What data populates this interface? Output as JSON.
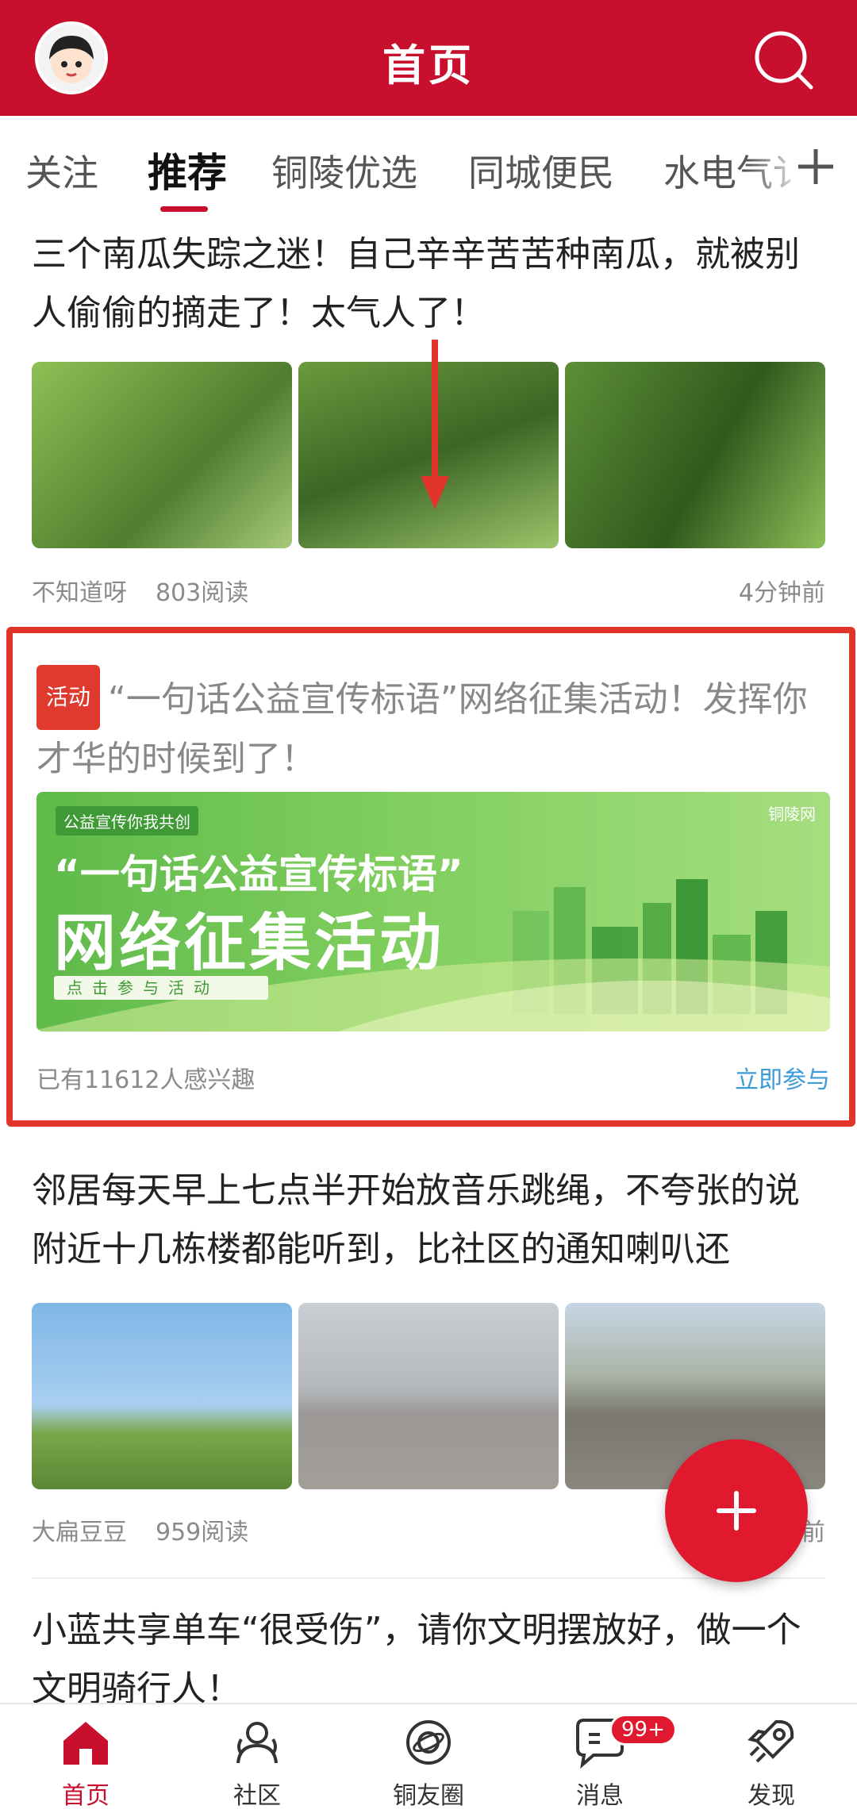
{
  "header": {
    "title": "首页"
  },
  "tabs": [
    {
      "label": "关注",
      "active": false
    },
    {
      "label": "推荐",
      "active": true
    },
    {
      "label": "铜陵优选",
      "active": false
    },
    {
      "label": "同城便民",
      "active": false
    },
    {
      "label": "水电气讠",
      "active": false
    }
  ],
  "feed": {
    "article1": {
      "title": "三个南瓜失踪之迷！自己辛辛苦苦种南瓜，就被别人偷偷的摘走了！太气人了！",
      "author": "不知道呀",
      "reads": "803阅读",
      "time": "4分钟前"
    },
    "activity": {
      "badge": "活动",
      "title": "“一句话公益宣传标语”网络征集活动！发挥你才华的时候到了！",
      "banner_tag": "公益宣传你我共创",
      "banner_logo": "铜陵网",
      "banner_quote": "“一句话公益宣传标语”",
      "banner_main": "网络征集活动",
      "banner_button": "点击参与活动",
      "interest": "已有11612人感兴趣",
      "join": "立即参与"
    },
    "article2": {
      "title": "邻居每天早上七点半开始放音乐跳绳，不夸张的说附近十几栋楼都能听到，比社区的通知喇叭还",
      "author": "大扁豆豆",
      "reads": "959阅读",
      "time": "前"
    },
    "article3": {
      "title": "小蓝共享单车“很受伤”，请你文明摆放好，做一个文明骑行人！"
    }
  },
  "bottom_nav": [
    {
      "label": "首页",
      "icon": "home-icon",
      "active": true
    },
    {
      "label": "社区",
      "icon": "community-icon",
      "active": false
    },
    {
      "label": "铜友圈",
      "icon": "planet-icon",
      "active": false
    },
    {
      "label": "消息",
      "icon": "message-icon",
      "active": false,
      "badge": "99+"
    },
    {
      "label": "发现",
      "icon": "rocket-icon",
      "active": false
    }
  ],
  "colors": {
    "brand": "#c8102e",
    "highlight_border": "#e1352b",
    "link": "#3a9bd6"
  }
}
